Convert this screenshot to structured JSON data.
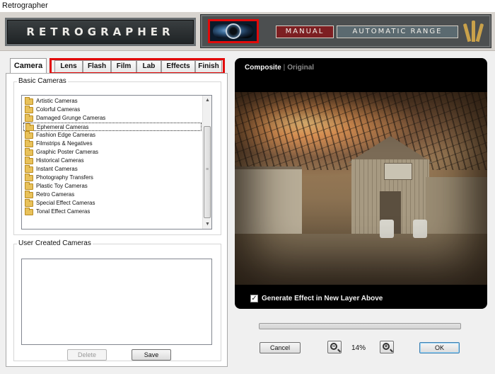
{
  "window": {
    "title": "Retrographer"
  },
  "banner": {
    "logo": "RETROGRAPHER",
    "mode_manual": "MANUAL",
    "mode_automatic": "AUTOMATIC RANGE"
  },
  "tabs": [
    "Camera",
    "Lens",
    "Flash",
    "Film",
    "Lab",
    "Effects",
    "Finish"
  ],
  "basic_cameras": {
    "title": "Basic Cameras",
    "items": [
      "Artistic Cameras",
      "Colorful Cameras",
      "Damaged Grunge Cameras",
      "Ephemeral Cameras",
      "Fashion Edge Cameras",
      "Filmstrips & Negatives",
      "Graphic Poster Cameras",
      "Historical Cameras",
      "Instant Cameras",
      "Photography Transfers",
      "Plastic Toy Cameras",
      "Retro Cameras",
      "Special Effect Cameras",
      "Tonal Effect Cameras"
    ],
    "selected": "Ephemeral Cameras"
  },
  "user_cameras": {
    "title": "User Created Cameras"
  },
  "buttons": {
    "delete": "Delete",
    "save": "Save",
    "cancel": "Cancel",
    "ok": "OK"
  },
  "preview": {
    "composite": "Composite",
    "separator": "|",
    "original": "Original",
    "generate_label": "Generate Effect in New Layer Above",
    "generate_checked": true,
    "checkmark": "✓"
  },
  "zoom": {
    "value": "14%",
    "zoom_out_icon": "zoom-out-icon",
    "zoom_in_icon": "zoom-in-icon",
    "minus": "−",
    "plus": "+"
  },
  "scroll": {
    "up": "▲",
    "down": "▼",
    "grip": "≡"
  },
  "colors": {
    "accent_red": "#e20a0a",
    "manual_bg": "#7d1f22",
    "auto_bg": "#5b6a70"
  }
}
